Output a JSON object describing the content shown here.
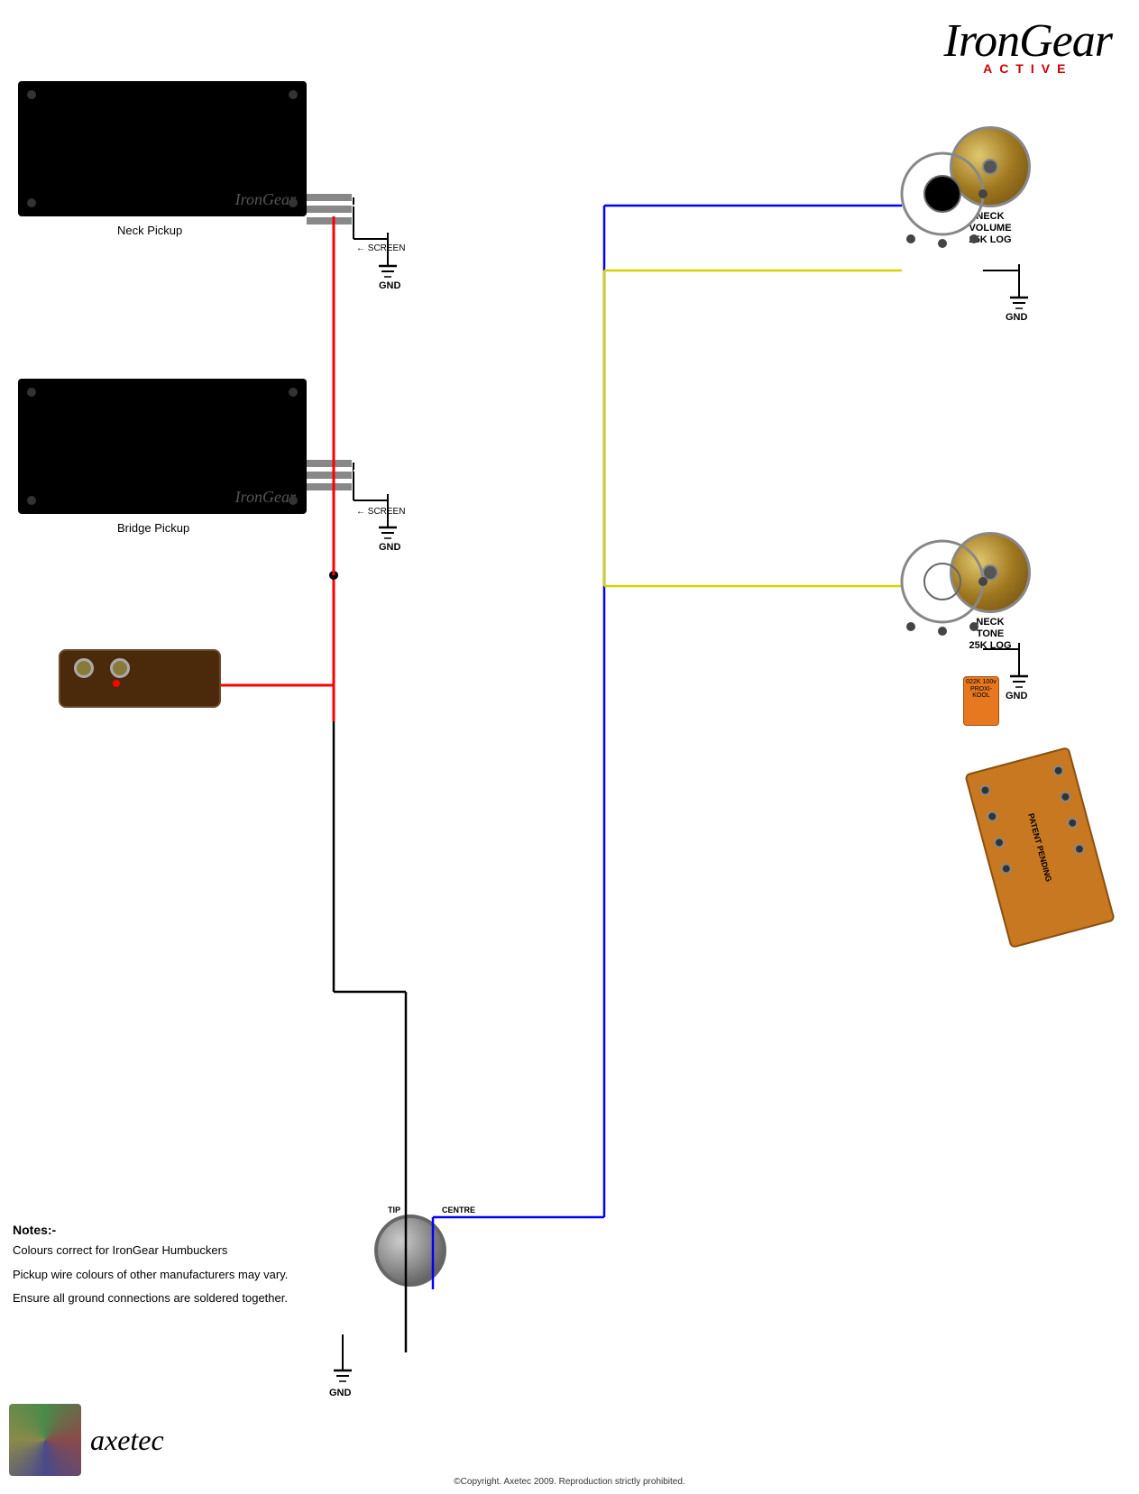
{
  "logo": {
    "brand": "IronGear",
    "iron": "Iron",
    "gear": "Gear",
    "active": "ACTIVE"
  },
  "pickups": {
    "neck": {
      "label": "IronGear",
      "caption": "Neck Pickup"
    },
    "bridge": {
      "label": "IronGear",
      "caption": "Bridge Pickup"
    }
  },
  "pots": {
    "neck_volume": {
      "label": "NECK\nVOLUME\n25K LOG"
    },
    "neck_tone": {
      "label": "NECK\nTONE\n25K LOG"
    }
  },
  "switch": {
    "label": "PATENT PENDING"
  },
  "gnd_labels": [
    "GND",
    "GND",
    "GND",
    "GND",
    "GND"
  ],
  "screen_labels": [
    "← SCREEN",
    "← SCREEN"
  ],
  "jack": {
    "tip": "TIP",
    "centre": "CENTRE"
  },
  "notes": {
    "title": "Notes:-",
    "items": [
      "Colours correct for IronGear Humbuckers",
      "Pickup wire colours of other manufacturers may vary.",
      "Ensure all ground connections are soldered together."
    ]
  },
  "axetec": {
    "name": "axetec",
    "copyright": "©Copyright. Axetec 2009. Reproduction strictly prohibited."
  },
  "capacitor": {
    "label": "022K 100v\nPROXI-KOOL"
  }
}
